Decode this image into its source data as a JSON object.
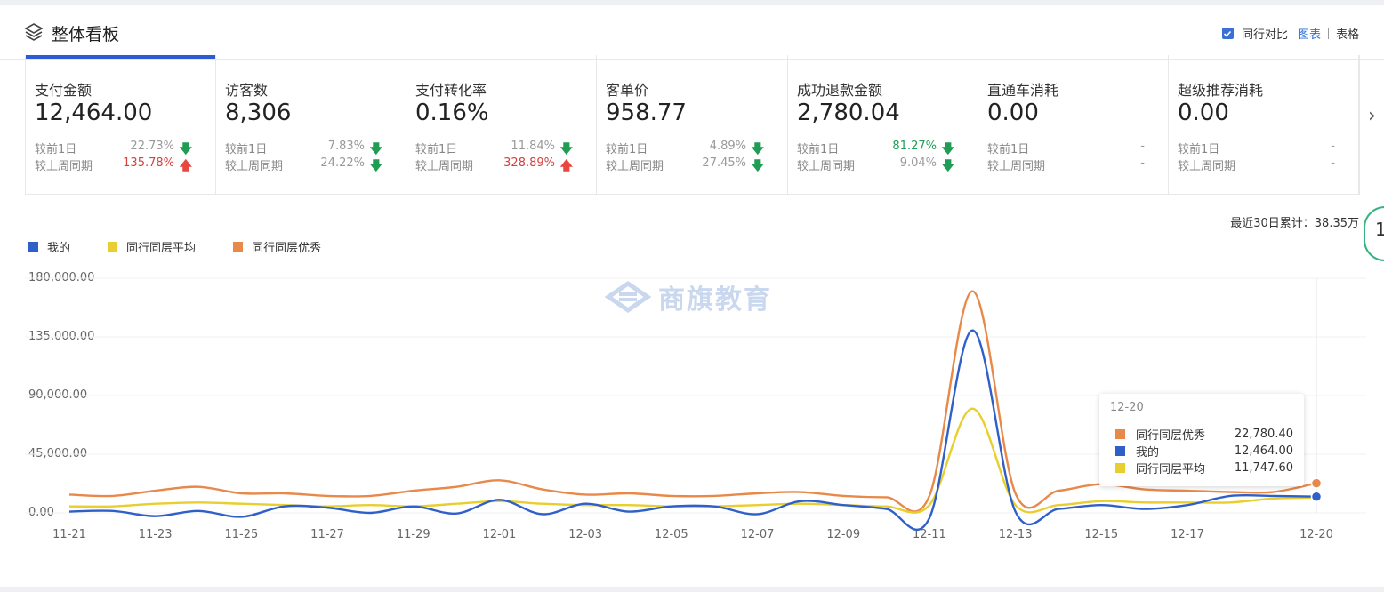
{
  "header": {
    "title": "整体看板",
    "compare_label": "同行对比",
    "chart_label": "图表",
    "table_label": "表格"
  },
  "metrics": [
    {
      "name": "支付金额",
      "value": "12,464.00",
      "r1_label": "较前1日",
      "r1_pct": "22.73%",
      "r1_dir": "down",
      "r1_color": "gy",
      "r2_label": "较上周同期",
      "r2_pct": "135.78%",
      "r2_dir": "up",
      "r2_color": "rd"
    },
    {
      "name": "访客数",
      "value": "8,306",
      "r1_label": "较前1日",
      "r1_pct": "7.83%",
      "r1_dir": "down",
      "r1_color": "gy",
      "r2_label": "较上周同期",
      "r2_pct": "24.22%",
      "r2_dir": "down",
      "r2_color": "gy"
    },
    {
      "name": "支付转化率",
      "value": "0.16%",
      "r1_label": "较前1日",
      "r1_pct": "11.84%",
      "r1_dir": "down",
      "r1_color": "gy",
      "r2_label": "较上周同期",
      "r2_pct": "328.89%",
      "r2_dir": "up",
      "r2_color": "rd"
    },
    {
      "name": "客单价",
      "value": "958.77",
      "r1_label": "较前1日",
      "r1_pct": "4.89%",
      "r1_dir": "down",
      "r1_color": "gy",
      "r2_label": "较上周同期",
      "r2_pct": "27.45%",
      "r2_dir": "down",
      "r2_color": "gy"
    },
    {
      "name": "成功退款金额",
      "value": "2,780.04",
      "r1_label": "较前1日",
      "r1_pct": "81.27%",
      "r1_dir": "down",
      "r1_color": "gd",
      "r2_label": "较上周同期",
      "r2_pct": "9.04%",
      "r2_dir": "down",
      "r2_color": "gy"
    },
    {
      "name": "直通车消耗",
      "value": "0.00",
      "r1_label": "较前1日",
      "r1_pct": "-",
      "r1_dir": "",
      "r1_color": "gy",
      "r2_label": "较上周同期",
      "r2_pct": "-",
      "r2_dir": "",
      "r2_color": "gy"
    },
    {
      "name": "超级推荐消耗",
      "value": "0.00",
      "r1_label": "较前1日",
      "r1_pct": "-",
      "r1_dir": "",
      "r1_color": "gy",
      "r2_label": "较上周同期",
      "r2_pct": "-",
      "r2_dir": "",
      "r2_color": "gy"
    }
  ],
  "summary": {
    "total_text": "最近30日累计：38.35万",
    "bubble": "1"
  },
  "watermark": "商旗教育",
  "tooltip": {
    "date": "12-20",
    "rows": [
      {
        "name": "同行同层优秀",
        "value": "22,780.40",
        "color": "#e8894a"
      },
      {
        "name": "我的",
        "value": "12,464.00",
        "color": "#2f5fc8"
      },
      {
        "name": "同行同层平均",
        "value": "11,747.60",
        "color": "#e8cf2f"
      }
    ]
  },
  "chart_data": {
    "type": "line",
    "x": [
      "11-21",
      "11-22",
      "11-23",
      "11-24",
      "11-25",
      "11-26",
      "11-27",
      "11-28",
      "11-29",
      "11-30",
      "12-01",
      "12-02",
      "12-03",
      "12-04",
      "12-05",
      "12-06",
      "12-07",
      "12-08",
      "12-09",
      "12-10",
      "12-11",
      "12-12",
      "12-13",
      "12-14",
      "12-15",
      "12-16",
      "12-17",
      "12-18",
      "12-19",
      "12-20"
    ],
    "x_ticks": [
      "11-21",
      "11-23",
      "11-25",
      "11-27",
      "11-29",
      "12-01",
      "12-03",
      "12-05",
      "12-07",
      "12-09",
      "12-11",
      "12-13",
      "12-15",
      "12-17",
      "12-20"
    ],
    "y_ticks": [
      "0.00",
      "45,000.00",
      "90,000.00",
      "135,000.00",
      "180,000.00"
    ],
    "ylim": [
      0,
      180000
    ],
    "grid": true,
    "legend_position": "top-left",
    "series": [
      {
        "name": "我的",
        "color": "#2f5fc8",
        "values": [
          1000,
          1500,
          -2500,
          1500,
          -3000,
          5000,
          4000,
          0,
          5000,
          -500,
          10000,
          -1000,
          7000,
          1000,
          5000,
          5000,
          -1000,
          9000,
          6000,
          3000,
          -4000,
          140000,
          1000,
          3000,
          6000,
          3000,
          6000,
          13000,
          13000,
          12464
        ]
      },
      {
        "name": "同行同层平均",
        "color": "#e8cf2f",
        "values": [
          5000,
          5000,
          7000,
          8000,
          7000,
          6000,
          5000,
          6000,
          5000,
          7000,
          9000,
          7000,
          6000,
          6000,
          5000,
          5000,
          6000,
          7000,
          6000,
          5000,
          6000,
          80000,
          6000,
          6000,
          9000,
          8000,
          8000,
          8000,
          11000,
          11747.6
        ]
      },
      {
        "name": "同行同层优秀",
        "color": "#e8894a",
        "values": [
          14000,
          13000,
          17000,
          20000,
          15000,
          15000,
          13000,
          13000,
          17000,
          20000,
          25000,
          18000,
          14000,
          15000,
          13000,
          13000,
          15000,
          16000,
          13000,
          12000,
          13000,
          170000,
          15000,
          17000,
          22000,
          18000,
          17000,
          16000,
          16000,
          22780.4
        ]
      }
    ]
  }
}
